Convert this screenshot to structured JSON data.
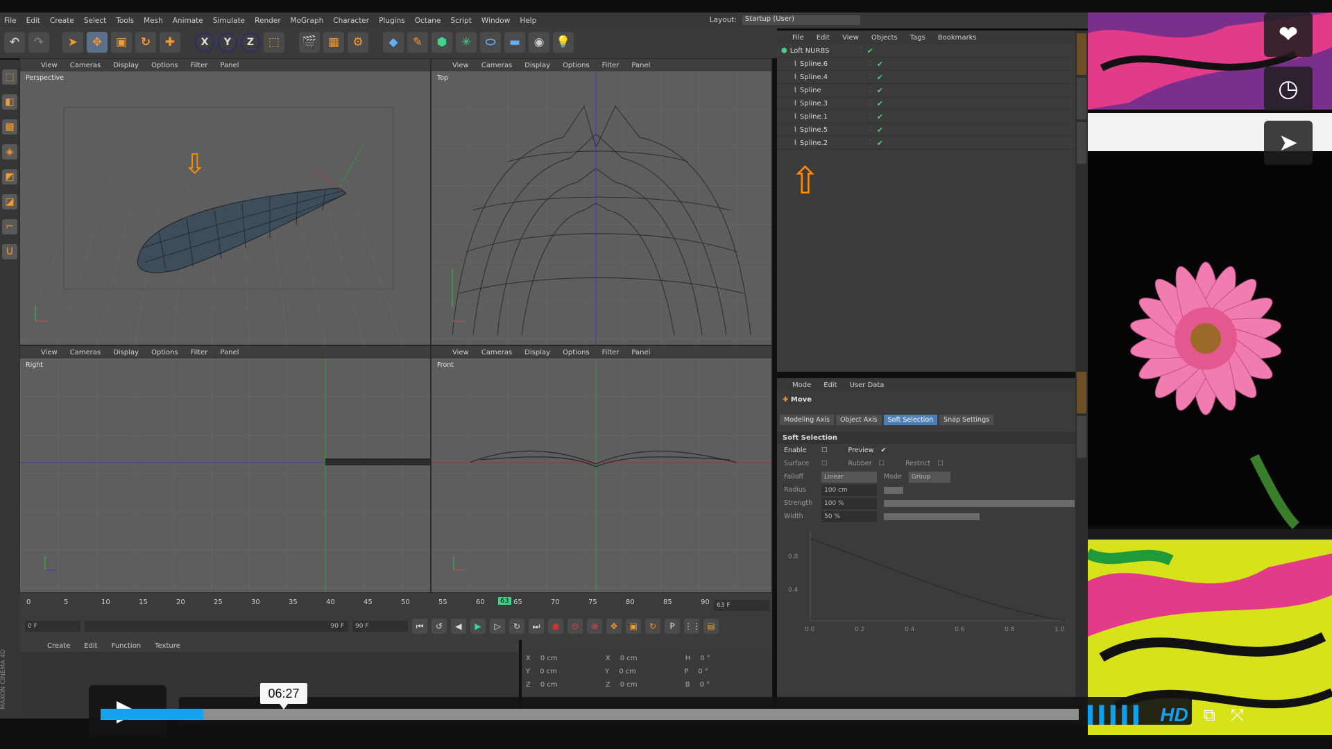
{
  "menu": {
    "items": [
      "File",
      "Edit",
      "Create",
      "Select",
      "Tools",
      "Mesh",
      "Animate",
      "Simulate",
      "Render",
      "MoGraph",
      "Character",
      "Plugins",
      "Octane",
      "Script",
      "Window",
      "Help"
    ],
    "layout_label": "Layout:",
    "layout_value": "Startup (User)"
  },
  "toolbar": {
    "axis_x": "X",
    "axis_y": "Y",
    "axis_z": "Z"
  },
  "viewport_menu": [
    "View",
    "Cameras",
    "Display",
    "Options",
    "Filter",
    "Panel"
  ],
  "viewports": {
    "perspective": "Perspective",
    "top": "Top",
    "right": "Right",
    "front": "Front"
  },
  "timeline": {
    "ticks": [
      "0",
      "5",
      "10",
      "15",
      "20",
      "25",
      "30",
      "35",
      "40",
      "45",
      "50",
      "55",
      "60",
      "65",
      "70",
      "75",
      "80",
      "85",
      "90"
    ],
    "current_frame": "63 F",
    "start_field": "0 F",
    "end_field": "90 F",
    "range_end": "90 F",
    "playhead_label": "63"
  },
  "material_menu": [
    "Create",
    "Edit",
    "Function",
    "Texture"
  ],
  "coords": {
    "rows": [
      {
        "a": "X",
        "av": "0 cm",
        "b": "X",
        "bv": "0 cm",
        "c": "H",
        "cv": "0 °"
      },
      {
        "a": "Y",
        "av": "0 cm",
        "b": "Y",
        "bv": "0 cm",
        "c": "P",
        "cv": "0 °"
      },
      {
        "a": "Z",
        "av": "0 cm",
        "b": "Z",
        "bv": "0 cm",
        "c": "B",
        "cv": "0 °"
      }
    ]
  },
  "object_manager": {
    "menu": [
      "File",
      "Edit",
      "View",
      "Objects",
      "Tags",
      "Bookmarks"
    ],
    "objects": [
      "Loft NURBS",
      "Spline.6",
      "Spline.4",
      "Spline",
      "Spline.3",
      "Spline.1",
      "Spline.5",
      "Spline.2"
    ]
  },
  "attributes": {
    "menu": [
      "Mode",
      "Edit",
      "User Data"
    ],
    "title": "Move",
    "tabs": [
      "Modeling Axis",
      "Object Axis",
      "Soft Selection",
      "Snap Settings"
    ],
    "section": "Soft Selection",
    "rows": [
      {
        "label": "Enable",
        "extra": "Preview"
      },
      {
        "label": "Surface",
        "extra": "Rubber",
        "extra2": "Restrict"
      },
      {
        "label": "Falloff",
        "value": "Linear",
        "extra": "Mode",
        "extra_value": "Group"
      },
      {
        "label": "Radius",
        "value": "100 cm"
      },
      {
        "label": "Strength",
        "value": "100 %"
      },
      {
        "label": "Width",
        "value": "50 %"
      }
    ],
    "graph_y_labels": [
      "0.8",
      "0.4"
    ],
    "graph_x_labels": [
      "0.0",
      "0.2",
      "0.4",
      "0.6",
      "0.8",
      "1.0"
    ]
  },
  "brand": "MAXON CINEMA 4D",
  "player": {
    "time_tooltip": "06:27",
    "progress": 0.105,
    "hd_label": "HD"
  },
  "colors": {
    "accent_orange": "#ff8a00",
    "progress_blue": "#15a2ef",
    "check_green": "#53d36a"
  }
}
